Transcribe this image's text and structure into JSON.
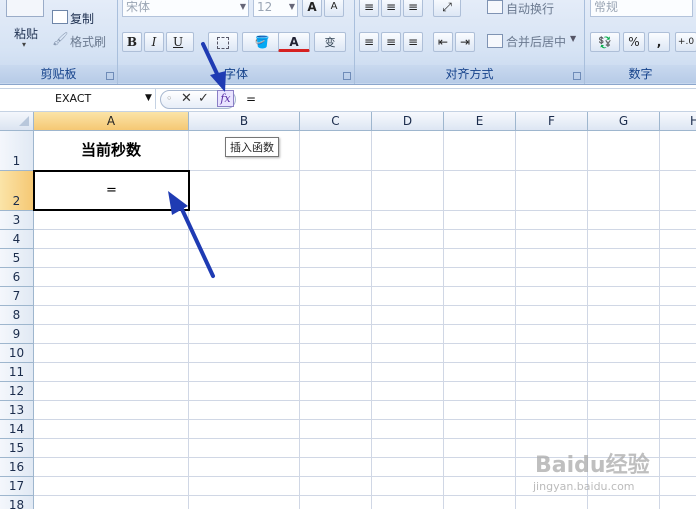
{
  "ribbon": {
    "clipboard": {
      "paste_label": "粘贴",
      "copy_label": "复制",
      "format_painter_label": "格式刷",
      "group_label": "剪贴板"
    },
    "font": {
      "font_name": "宋体",
      "font_size": "12",
      "bold": "B",
      "italic": "I",
      "underline": "U",
      "group_label": "字体",
      "grow": "A",
      "shrink": "A"
    },
    "alignment": {
      "wrap_text": "自动换行",
      "merge_center": "合并后居中",
      "group_label": "对齐方式"
    },
    "number": {
      "format": "常规",
      "percent": "%",
      "comma": ",",
      "group_label": "数字"
    }
  },
  "formula_bar": {
    "name_box": "EXACT",
    "formula": "=",
    "insert_function_tooltip": "插入函数"
  },
  "grid": {
    "columns": [
      "A",
      "B",
      "C",
      "D",
      "E",
      "F",
      "G",
      "H"
    ],
    "rows": [
      "1",
      "2",
      "3",
      "4",
      "5",
      "6",
      "7",
      "8",
      "9",
      "10",
      "11",
      "12",
      "13",
      "14",
      "15",
      "16",
      "17",
      "18"
    ],
    "cells": {
      "A1": "当前秒数",
      "A2": "="
    }
  },
  "watermark": {
    "logo": "Baidu经验",
    "url": "jingyan.baidu.com"
  },
  "colors": {
    "arrow": "#1f3bb3",
    "selected_header": "#f5c874",
    "ribbon_label": "#15428b"
  }
}
